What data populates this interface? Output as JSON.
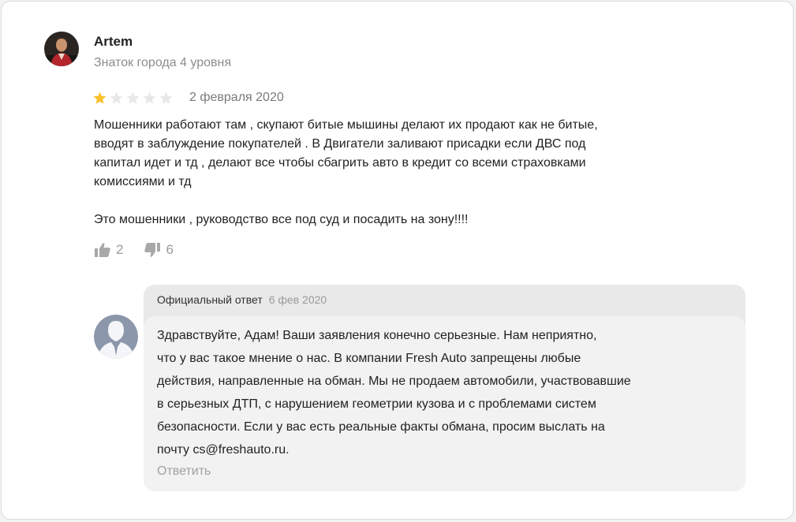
{
  "review": {
    "author": {
      "name": "Artem",
      "status": "Знаток города 4 уровня"
    },
    "rating": 1,
    "rating_max": 5,
    "date": "2 февраля 2020",
    "text": "Мошенники работают там , скупают битые мышины делают их продают как не битые,\nвводят в заблуждение покупателей . В Двигатели заливают присадки если ДВС под\nкапитал идет и тд , делают все чтобы сбагрить авто в кредит со всеми страховками\nкомиссиями и тд\n\nЭто мошенники , руководство все под суд и посадить на зону!!!!",
    "likes": "2",
    "dislikes": "6"
  },
  "reply": {
    "label": "Официальный ответ",
    "date": "6 фев 2020",
    "text": "Здравствуйте, Адам! Ваши заявления конечно серьезные. Нам неприятно,\nчто у вас такое мнение о нас. В компании Fresh Auto запрещены любые\nдействия, направленные на обман. Мы не продаем автомобили, участвовавшие\nв серьезных ДТП, с нарушением геометрии кузова и с проблемами систем\nбезопасности. Если у вас есть реальные факты обмана, просим выслать на\nпочту cs@freshauto.ru.",
    "action": "Ответить"
  },
  "colors": {
    "star_filled": "#fcc02a",
    "star_empty": "#e8e8e8",
    "muted_text": "#9a9a9a",
    "reply_header_bg": "#e9e9e9",
    "reply_body_bg": "#f2f2f2",
    "org_avatar_bg": "#8d97ab"
  },
  "icons": {
    "like": "thumbs-up-icon",
    "dislike": "thumbs-down-icon",
    "org_avatar": "person-silhouette-icon"
  }
}
